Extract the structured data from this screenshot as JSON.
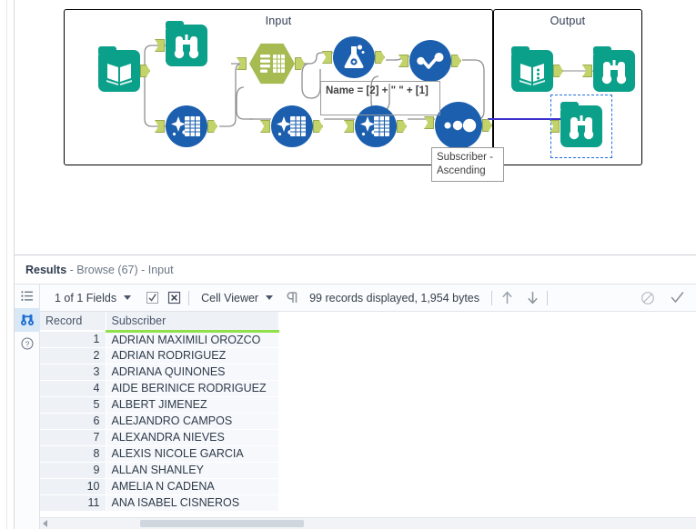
{
  "canvas": {
    "containers": [
      {
        "id": "input",
        "label": "Input"
      },
      {
        "id": "output",
        "label": "Output"
      }
    ],
    "annotations": [
      {
        "id": "formula",
        "text": "Name = [2] + \" \" + [1]"
      },
      {
        "id": "sort",
        "text": "Subscriber -\nAscending"
      }
    ],
    "nodes": [
      {
        "id": "input-data",
        "icon": "book-icon",
        "tool": "Input Data"
      },
      {
        "id": "browse-1",
        "icon": "binoculars-icon",
        "tool": "Browse"
      },
      {
        "id": "cleanse-1",
        "icon": "sparkle-grid-icon",
        "tool": "Data Cleansing"
      },
      {
        "id": "text-input",
        "icon": "table-hex-icon",
        "tool": "Text Input"
      },
      {
        "id": "formula-1",
        "icon": "flask-icon",
        "tool": "Formula"
      },
      {
        "id": "select-1",
        "icon": "check-dots-icon",
        "tool": "Select"
      },
      {
        "id": "cleanse-2",
        "icon": "sparkle-grid-icon",
        "tool": "Data Cleansing"
      },
      {
        "id": "cleanse-3",
        "icon": "sparkle-grid-icon",
        "tool": "Data Cleansing"
      },
      {
        "id": "sort-1",
        "icon": "three-dots-icon",
        "tool": "Sort"
      },
      {
        "id": "output-data",
        "icon": "book-dots-icon",
        "tool": "Output Data"
      },
      {
        "id": "browse-output",
        "icon": "binoculars-icon",
        "tool": "Browse"
      },
      {
        "id": "browse-selected",
        "icon": "binoculars-icon",
        "tool": "Browse",
        "selected": true
      }
    ],
    "colors": {
      "teal": "#0aa08a",
      "blue": "#1b5fae",
      "olive": "#a6bb52",
      "port": "#c3d36a",
      "selected_connection": "#3b2fd0",
      "selection_border": "#1f6fe0"
    }
  },
  "results": {
    "title_strong": "Results",
    "title_rest": " - Browse (67) - Input",
    "rail": [
      {
        "name": "list-view-icon"
      },
      {
        "name": "browse-icon",
        "active": true
      },
      {
        "name": "help-icon"
      }
    ],
    "toolbar": {
      "fields_label": "1 of 1 Fields",
      "select_all_icon": "checkbox-checked-icon",
      "deselect_all_icon": "checkbox-x-icon",
      "viewer_label": "Cell Viewer",
      "pilcrow_icon": "pilcrow-icon",
      "records_label": "99 records displayed, 1,954 bytes",
      "up_arrow_icon": "arrow-up-icon",
      "down_arrow_icon": "arrow-down-icon",
      "block_icon": "no-entry-icon",
      "check_icon": "checkmark-icon"
    },
    "grid": {
      "columns": [
        "Record",
        "Subscriber"
      ],
      "rows": [
        {
          "record": "1",
          "subscriber": "ADRIAN MAXIMILI OROZCO"
        },
        {
          "record": "2",
          "subscriber": "ADRIAN RODRIGUEZ"
        },
        {
          "record": "3",
          "subscriber": "ADRIANA QUINONES"
        },
        {
          "record": "4",
          "subscriber": "AIDE BERINICE RODRIGUEZ"
        },
        {
          "record": "5",
          "subscriber": "ALBERT JIMENEZ"
        },
        {
          "record": "6",
          "subscriber": "ALEJANDRO CAMPOS"
        },
        {
          "record": "7",
          "subscriber": "ALEXANDRA NIEVES"
        },
        {
          "record": "8",
          "subscriber": "ALEXIS NICOLE GARCIA"
        },
        {
          "record": "9",
          "subscriber": "ALLAN SHANLEY"
        },
        {
          "record": "10",
          "subscriber": "AMELIA N CADENA"
        },
        {
          "record": "11",
          "subscriber": "ANA ISABEL CISNEROS"
        }
      ]
    }
  }
}
